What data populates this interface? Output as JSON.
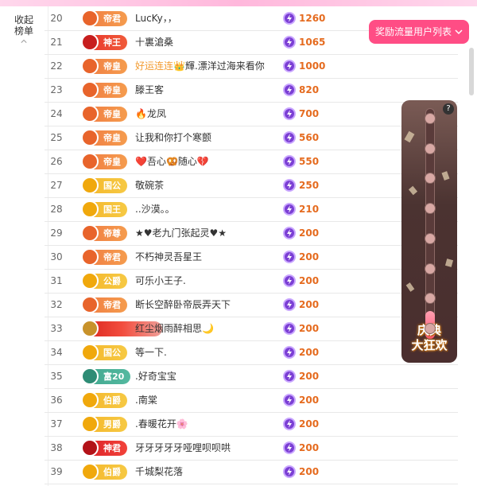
{
  "sidebar": {
    "collapse_label": "收起\n榜单"
  },
  "reward_button": {
    "label": "奖励流量用户列表"
  },
  "meter": {
    "help": "?",
    "festival_text": "庆典\n大狂欢",
    "fill_fraction": 0.12,
    "dot_count": 8
  },
  "rows": [
    {
      "rank": "20",
      "badge": "帝君",
      "badge_style": "orange",
      "name": "LucKy，，",
      "score": "1260"
    },
    {
      "rank": "21",
      "badge": "神王",
      "badge_style": "red",
      "name": "十裏滄桑",
      "score": "1065"
    },
    {
      "rank": "22",
      "badge": "帝皇",
      "badge_style": "orange",
      "name_special": "好运连连",
      "name": "輝.漂洋过海来看你",
      "score": "1000"
    },
    {
      "rank": "23",
      "badge": "帝皇",
      "badge_style": "orange",
      "name": "滕王客",
      "score": "820"
    },
    {
      "rank": "24",
      "badge": "帝皇",
      "badge_style": "orange",
      "name": "🔥龙凤",
      "score": "700"
    },
    {
      "rank": "25",
      "badge": "帝皇",
      "badge_style": "orange",
      "name": "让我和你打个寒颤",
      "score": "560"
    },
    {
      "rank": "26",
      "badge": "帝皇",
      "badge_style": "orange",
      "name": "❤️吾心🥨随心💔",
      "score": "550"
    },
    {
      "rank": "27",
      "badge": "国公",
      "badge_style": "gold",
      "name": "敬碗茶",
      "score": "250"
    },
    {
      "rank": "28",
      "badge": "国王",
      "badge_style": "gold",
      "name": "..沙漠。。",
      "score": "210"
    },
    {
      "rank": "29",
      "badge": "帝尊",
      "badge_style": "orange",
      "name": "★♥老九门张起灵♥★",
      "score": "200"
    },
    {
      "rank": "30",
      "badge": "帝君",
      "badge_style": "orange",
      "name": "不朽神灵吾星王",
      "score": "200"
    },
    {
      "rank": "31",
      "badge": "公爵",
      "badge_style": "gold",
      "name": "可乐小王子.",
      "score": "200"
    },
    {
      "rank": "32",
      "badge": "帝君",
      "badge_style": "orange",
      "name": "断长空醉卧帝辰弄天下",
      "score": "200"
    },
    {
      "rank": "33",
      "badge": "",
      "badge_style": "redfull",
      "name": "红尘烟雨醉相思🌙",
      "score": "200"
    },
    {
      "rank": "34",
      "badge": "国公",
      "badge_style": "gold",
      "name": "等一下.",
      "score": "200"
    },
    {
      "rank": "35",
      "badge": "富20",
      "badge_style": "teal",
      "name": ".好奇宝宝",
      "score": "200"
    },
    {
      "rank": "36",
      "badge": "伯爵",
      "badge_style": "gold",
      "name": ".南棠",
      "score": "200"
    },
    {
      "rank": "37",
      "badge": "男爵",
      "badge_style": "gold",
      "name": ".春暖花开🌸",
      "score": "200"
    },
    {
      "rank": "38",
      "badge": "神君",
      "badge_style": "crimson",
      "name": "牙牙牙牙牙哑哩呗呗哄",
      "score": "200"
    },
    {
      "rank": "39",
      "badge": "伯爵",
      "badge_style": "gold",
      "name": "千城梨花落",
      "score": "200"
    }
  ]
}
